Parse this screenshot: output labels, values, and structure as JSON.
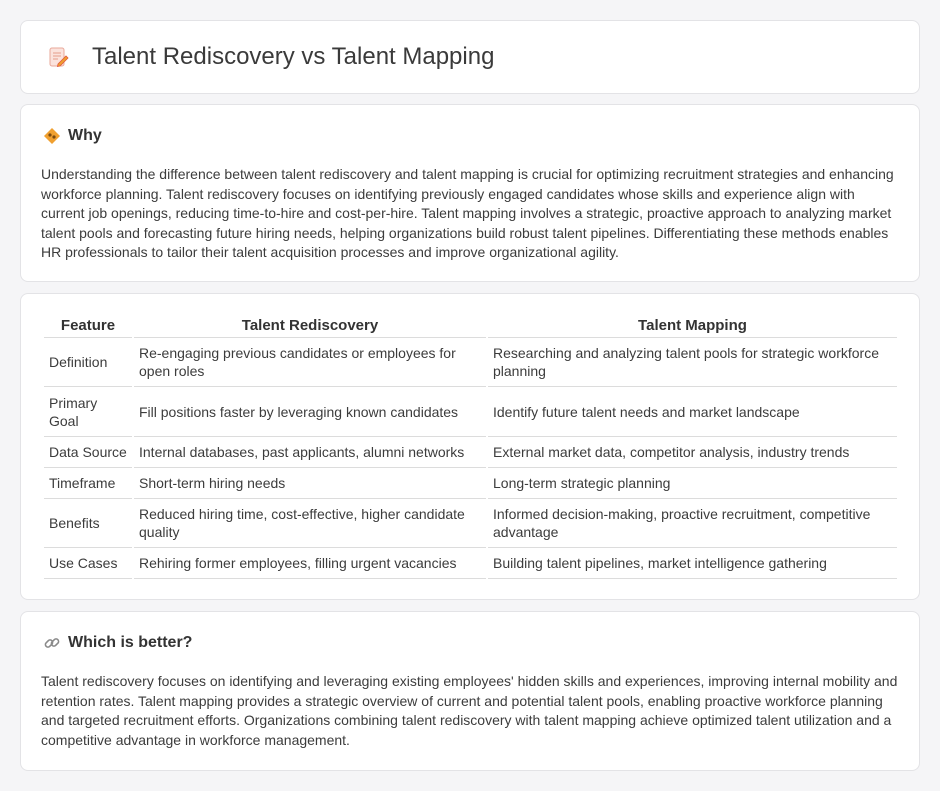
{
  "header": {
    "title": "Talent Rediscovery vs Talent Mapping",
    "icon": "document-pencil-icon"
  },
  "why": {
    "heading": "Why",
    "icon": "diamond-sign-icon",
    "body": "Understanding the difference between talent rediscovery and talent mapping is crucial for optimizing recruitment strategies and enhancing workforce planning. Talent rediscovery focuses on identifying previously engaged candidates whose skills and experience align with current job openings, reducing time-to-hire and cost-per-hire. Talent mapping involves a strategic, proactive approach to analyzing market talent pools and forecasting future hiring needs, helping organizations build robust talent pipelines. Differentiating these methods enables HR professionals to tailor their talent acquisition processes and improve organizational agility."
  },
  "comparison": {
    "headers": [
      "Feature",
      "Talent Rediscovery",
      "Talent Mapping"
    ],
    "rows": [
      [
        "Definition",
        "Re-engaging previous candidates or employees for open roles",
        "Researching and analyzing talent pools for strategic workforce planning"
      ],
      [
        "Primary Goal",
        "Fill positions faster by leveraging known candidates",
        "Identify future talent needs and market landscape"
      ],
      [
        "Data Source",
        "Internal databases, past applicants, alumni networks",
        "External market data, competitor analysis, industry trends"
      ],
      [
        "Timeframe",
        "Short-term hiring needs",
        "Long-term strategic planning"
      ],
      [
        "Benefits",
        "Reduced hiring time, cost-effective, higher candidate quality",
        "Informed decision-making, proactive recruitment, competitive advantage"
      ],
      [
        "Use Cases",
        "Rehiring former employees, filling urgent vacancies",
        "Building talent pipelines, market intelligence gathering"
      ]
    ]
  },
  "better": {
    "heading": "Which is better?",
    "icon": "link-icon",
    "body": "Talent rediscovery focuses on identifying and leveraging existing employees' hidden skills and experiences, improving internal mobility and retention rates. Talent mapping provides a strategic overview of current and potential talent pools, enabling proactive workforce planning and targeted recruitment efforts. Organizations combining talent rediscovery with talent mapping achieve optimized talent utilization and a competitive advantage in workforce management."
  },
  "colors": {
    "background": "#f5f5f7",
    "card": "#ffffff",
    "icon_orange": "#f0a030",
    "icon_red": "#e0583a"
  }
}
